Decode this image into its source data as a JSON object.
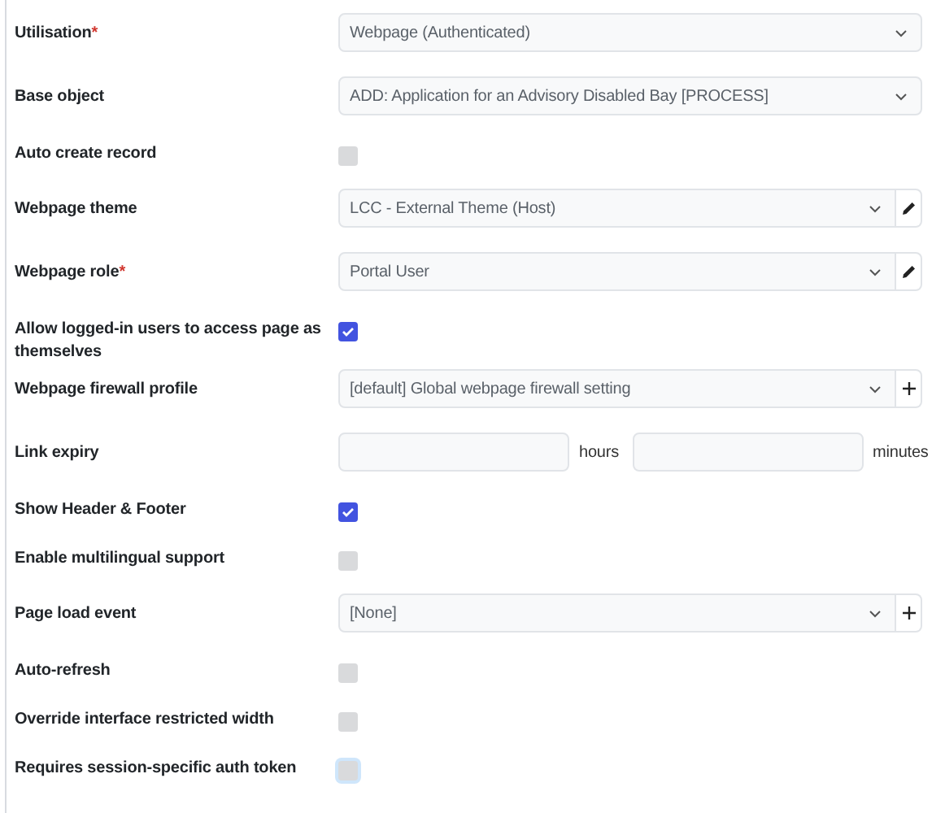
{
  "fields": [
    {
      "kind": "select",
      "label": "Utilisation",
      "required_mark": "*",
      "value": "Webpage (Authenticated)"
    },
    {
      "kind": "select",
      "label": "Base object",
      "value": "ADD: Application for an Advisory Disabled Bay [PROCESS]"
    },
    {
      "kind": "checkbox",
      "label": "Auto create record",
      "checked": false,
      "focused": false
    },
    {
      "kind": "select-edit",
      "label": "Webpage theme",
      "value": "LCC - External Theme (Host)"
    },
    {
      "kind": "select-edit",
      "label": "Webpage role",
      "required_mark": "*",
      "value": "Portal User"
    },
    {
      "kind": "checkbox",
      "label": "Allow logged-in users to access page as themselves",
      "checked": true,
      "focused": false
    },
    {
      "kind": "select-add",
      "label": "Webpage firewall profile",
      "value": "[default] Global webpage firewall setting"
    },
    {
      "kind": "duration",
      "label": "Link expiry",
      "units": [
        "hours",
        "minutes"
      ]
    },
    {
      "kind": "checkbox",
      "label": "Show Header & Footer",
      "checked": true,
      "focused": false
    },
    {
      "kind": "checkbox",
      "label": "Enable multilingual support",
      "checked": false,
      "focused": false
    },
    {
      "kind": "select-add",
      "label": "Page load event",
      "value": "[None]"
    },
    {
      "kind": "checkbox",
      "label": "Auto-refresh",
      "checked": false,
      "focused": false
    },
    {
      "kind": "checkbox",
      "label": "Override interface restricted width",
      "checked": false,
      "focused": false
    },
    {
      "kind": "checkbox",
      "label": "Requires session-specific auth token",
      "checked": false,
      "focused": true
    }
  ]
}
